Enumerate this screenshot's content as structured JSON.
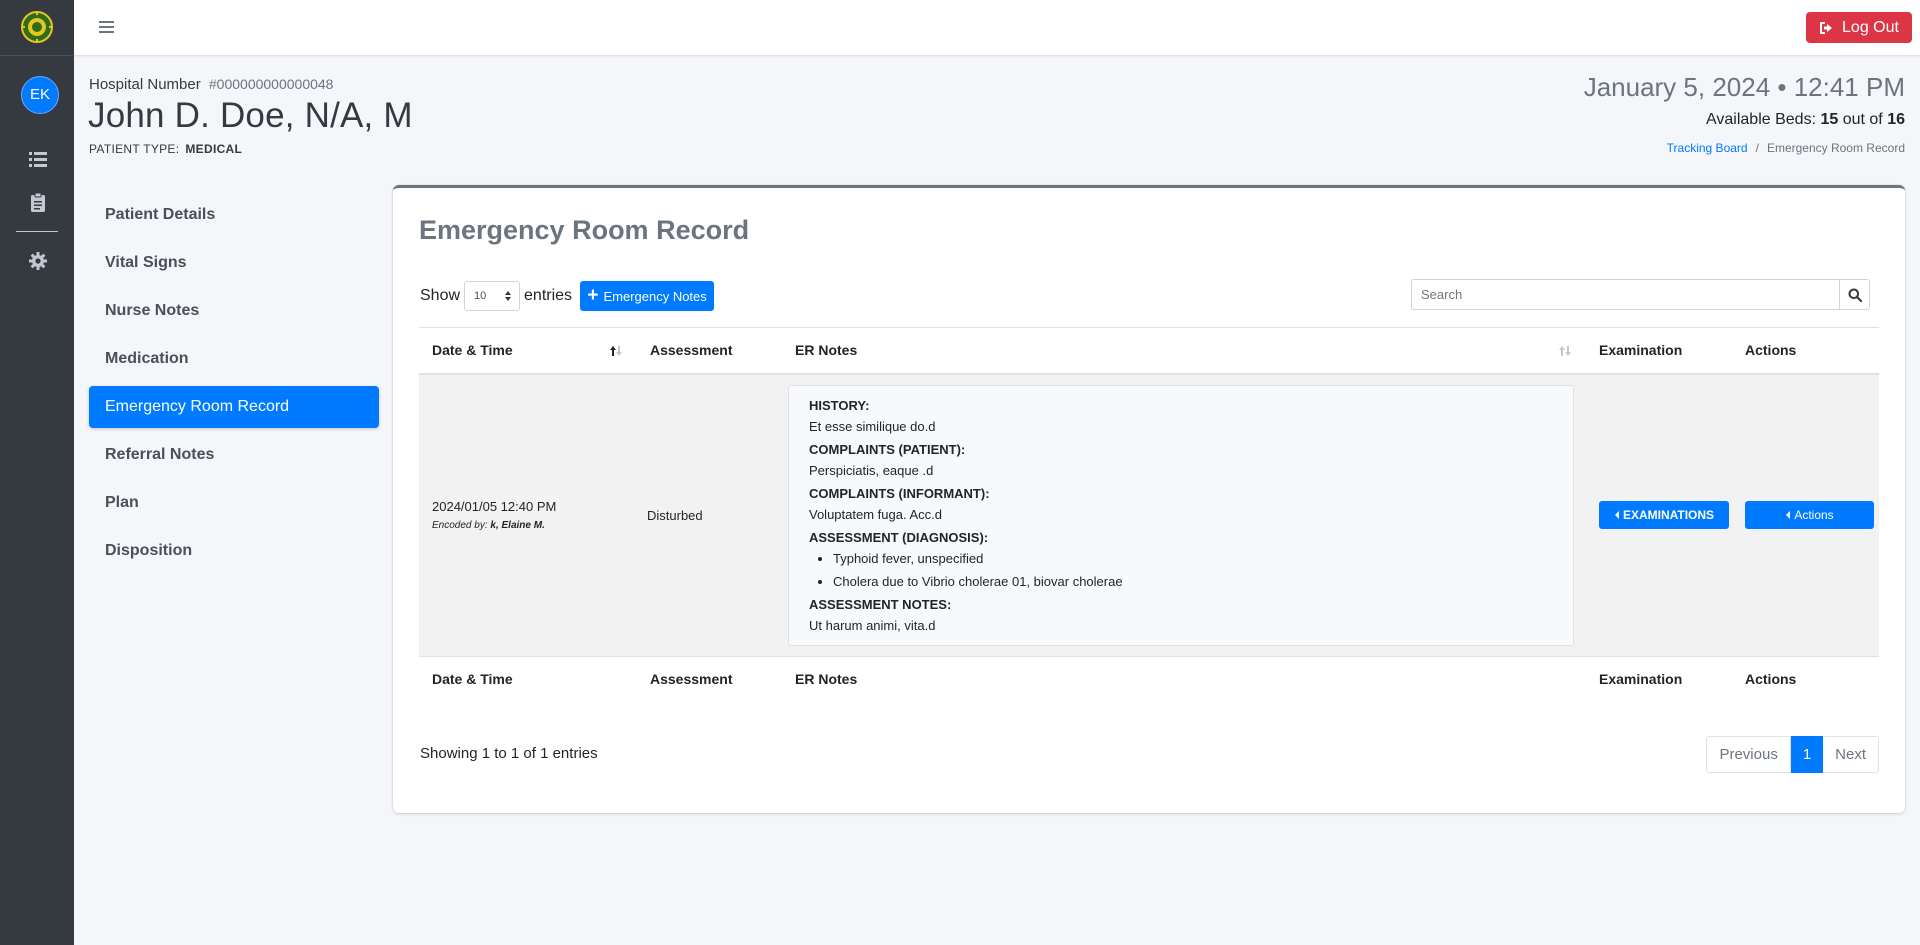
{
  "header": {
    "logout_label": "Log Out"
  },
  "sidebar_rail": {
    "avatar_initials": "EK"
  },
  "patient": {
    "hospital_number_label": "Hospital Number",
    "hospital_number": "#000000000000048",
    "name": "John D. Doe, N/A, M",
    "type_label": "PATIENT TYPE:",
    "type_value": "MEDICAL"
  },
  "status": {
    "datetime": "January 5, 2024 • 12:41 PM",
    "beds_label": "Available Beds:",
    "beds_available": "15",
    "beds_of": "out of",
    "beds_total": "16"
  },
  "breadcrumb": {
    "link": "Tracking Board",
    "separator": "/",
    "current": "Emergency Room Record"
  },
  "nav": {
    "items": [
      {
        "label": "Patient Details"
      },
      {
        "label": "Vital Signs"
      },
      {
        "label": "Nurse Notes"
      },
      {
        "label": "Medication"
      },
      {
        "label": "Emergency Room Record"
      },
      {
        "label": "Referral Notes"
      },
      {
        "label": "Plan"
      },
      {
        "label": "Disposition"
      }
    ],
    "active_index": 4
  },
  "card": {
    "title": "Emergency Room Record",
    "show_label": "Show",
    "entries_value": "10",
    "entries_label": "entries",
    "add_button_label": "Emergency Notes",
    "search_placeholder": "Search"
  },
  "table": {
    "columns": [
      "Date & Time",
      "Assessment",
      "ER Notes",
      "Examination",
      "Actions"
    ],
    "rows": [
      {
        "datetime": "2024/01/05 12:40 PM",
        "encoded_by_label": "Encoded by:",
        "encoded_by": "k, Elaine M.",
        "assessment": "Disturbed",
        "notes": {
          "history_label": "HISTORY:",
          "history": "Et esse similique do.d",
          "complaints_patient_label": "COMPLAINTS (PATIENT):",
          "complaints_patient": "Perspiciatis, eaque .d",
          "complaints_informant_label": "COMPLAINTS (INFORMANT):",
          "complaints_informant": "Voluptatem fuga. Acc.d",
          "diagnosis_label": "ASSESSMENT (DIAGNOSIS):",
          "diagnoses": [
            "Typhoid fever, unspecified",
            "Cholera due to Vibrio cholerae 01, biovar cholerae"
          ],
          "assessment_notes_label": "ASSESSMENT NOTES:",
          "assessment_notes": "Ut harum animi, vita.d"
        },
        "examination_button": "EXAMINATIONS",
        "actions_button": "Actions"
      }
    ]
  },
  "footer": {
    "info": "Showing 1 to 1 of 1 entries",
    "prev_label": "Previous",
    "current_page": "1",
    "next_label": "Next"
  },
  "colors": {
    "primary": "#007bff",
    "danger": "#dc3545",
    "rail": "#343a40"
  }
}
